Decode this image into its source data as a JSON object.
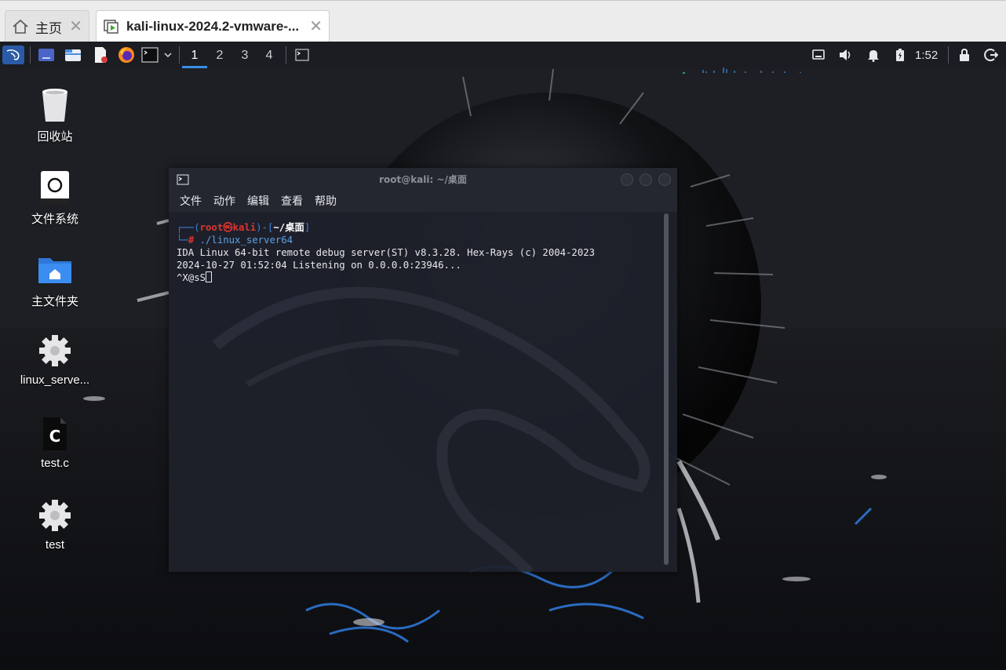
{
  "vm_tabs": {
    "home_label": "主页",
    "vm_label": "kali-linux-2024.2-vmware-..."
  },
  "panel": {
    "workspaces": [
      "1",
      "2",
      "3",
      "4"
    ],
    "clock": "1:52"
  },
  "desktop_icons": [
    {
      "label": "回收站",
      "icon": "trash-icon"
    },
    {
      "label": "文件系统",
      "icon": "filesystem-icon"
    },
    {
      "label": "主文件夹",
      "icon": "home-folder-icon"
    },
    {
      "label": "linux_serve...",
      "icon": "gear-icon"
    },
    {
      "label": "test.c",
      "icon": "c-source-file-icon"
    },
    {
      "label": "test",
      "icon": "gear-icon"
    }
  ],
  "terminal": {
    "title": "root@kali: ~/桌面",
    "menu": [
      "文件",
      "动作",
      "编辑",
      "查看",
      "帮助"
    ],
    "prompt": {
      "user": "root",
      "host": "kali",
      "cwd": "~/桌面",
      "command": "./linux_server64"
    },
    "output": [
      "IDA Linux 64-bit remote debug server(ST) v8.3.28. Hex-Rays (c) 2004-2023",
      "2024-10-27 01:52:04 Listening on 0.0.0.0:23946..."
    ],
    "input_line": "^X@sS"
  },
  "colors": {
    "panel_bg": "#1b1d22",
    "terminal_bg": "#1e212a",
    "prompt_red": "#e0322f",
    "prompt_blue": "#3f7fd6",
    "active_workspace": "#3a8ee6"
  }
}
